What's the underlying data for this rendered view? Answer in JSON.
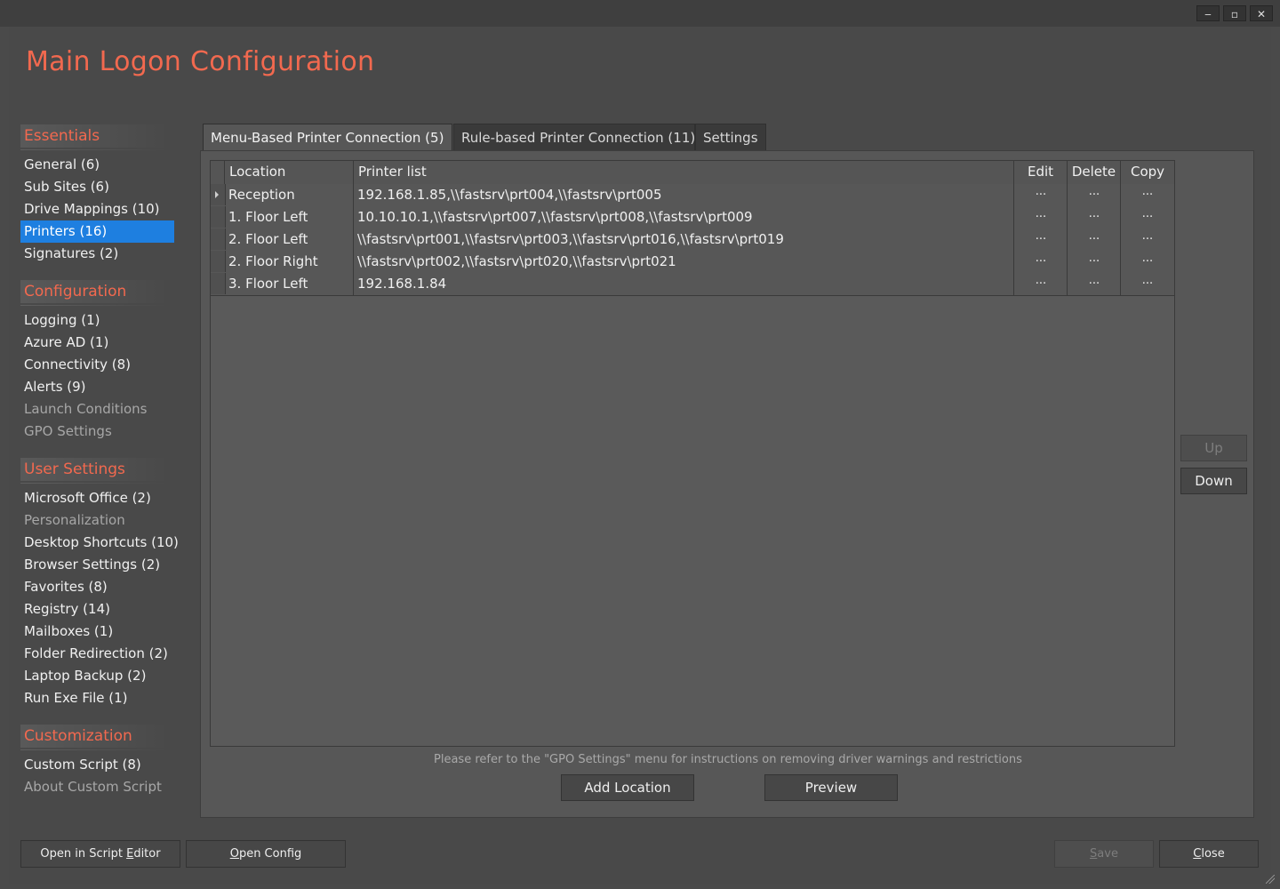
{
  "window": {
    "title": "Main Logon Configuration",
    "controls": {
      "minimize": "‒",
      "maximize": "▫",
      "close": "✕"
    }
  },
  "sidebar": {
    "sections": [
      {
        "title": "Essentials",
        "items": [
          {
            "label": "General (6)",
            "state": "normal"
          },
          {
            "label": "Sub Sites (6)",
            "state": "normal"
          },
          {
            "label": "Drive Mappings (10)",
            "state": "normal"
          },
          {
            "label": "Printers (16)",
            "state": "selected"
          },
          {
            "label": "Signatures (2)",
            "state": "normal"
          }
        ]
      },
      {
        "title": "Configuration",
        "items": [
          {
            "label": "Logging (1)",
            "state": "normal"
          },
          {
            "label": "Azure AD (1)",
            "state": "normal"
          },
          {
            "label": "Connectivity (8)",
            "state": "normal"
          },
          {
            "label": "Alerts (9)",
            "state": "normal"
          },
          {
            "label": "Launch Conditions",
            "state": "disabled"
          },
          {
            "label": "GPO Settings",
            "state": "disabled"
          }
        ]
      },
      {
        "title": "User Settings",
        "items": [
          {
            "label": "Microsoft Office (2)",
            "state": "normal"
          },
          {
            "label": "Personalization",
            "state": "disabled"
          },
          {
            "label": "Desktop Shortcuts (10)",
            "state": "normal"
          },
          {
            "label": "Browser Settings (2)",
            "state": "normal"
          },
          {
            "label": "Favorites (8)",
            "state": "normal"
          },
          {
            "label": "Registry (14)",
            "state": "normal"
          },
          {
            "label": "Mailboxes (1)",
            "state": "normal"
          },
          {
            "label": "Folder Redirection (2)",
            "state": "normal"
          },
          {
            "label": "Laptop Backup (2)",
            "state": "normal"
          },
          {
            "label": "Run Exe File (1)",
            "state": "normal"
          }
        ]
      },
      {
        "title": "Customization",
        "items": [
          {
            "label": "Custom Script (8)",
            "state": "normal"
          },
          {
            "label": "About Custom Script",
            "state": "disabled"
          }
        ]
      }
    ]
  },
  "tabs": [
    {
      "label": "Menu-Based Printer Connection (5)",
      "active": true
    },
    {
      "label": "Rule-based Printer Connection (11)",
      "active": false
    },
    {
      "label": "Settings",
      "active": false
    }
  ],
  "grid": {
    "columns": {
      "location": "Location",
      "printers": "Printer list",
      "edit": "Edit",
      "delete": "Delete",
      "copy": "Copy"
    },
    "action_glyph": "···",
    "rows": [
      {
        "location": "Reception",
        "printers": "192.168.1.85,\\\\fastsrv\\prt004,\\\\fastsrv\\prt005",
        "current": true
      },
      {
        "location": "1. Floor Left",
        "printers": "10.10.10.1,\\\\fastsrv\\prt007,\\\\fastsrv\\prt008,\\\\fastsrv\\prt009",
        "current": false
      },
      {
        "location": "2. Floor Left",
        "printers": "\\\\fastsrv\\prt001,\\\\fastsrv\\prt003,\\\\fastsrv\\prt016,\\\\fastsrv\\prt019",
        "current": false
      },
      {
        "location": "2. Floor Right",
        "printers": "\\\\fastsrv\\prt002,\\\\fastsrv\\prt020,\\\\fastsrv\\prt021",
        "current": false
      },
      {
        "location": "3. Floor Left",
        "printers": "192.168.1.84",
        "current": false
      }
    ]
  },
  "side_buttons": {
    "up": "Up",
    "down": "Down"
  },
  "panel": {
    "note": "Please refer to the \"GPO Settings\" menu for instructions on removing driver warnings and restrictions",
    "add_location": "Add Location",
    "preview": "Preview"
  },
  "footer": {
    "open_script_editor_pre": "Open in Script ",
    "open_script_editor_u": "E",
    "open_script_editor_post": "ditor",
    "open_config_u": "O",
    "open_config_post": "pen Config",
    "save_u": "S",
    "save_post": "ave",
    "close_u": "C",
    "close_post": "lose"
  },
  "colors": {
    "accent": "#f2694f",
    "selection": "#1e7fe0",
    "background": "#4a4a4a",
    "panel": "#575757"
  }
}
